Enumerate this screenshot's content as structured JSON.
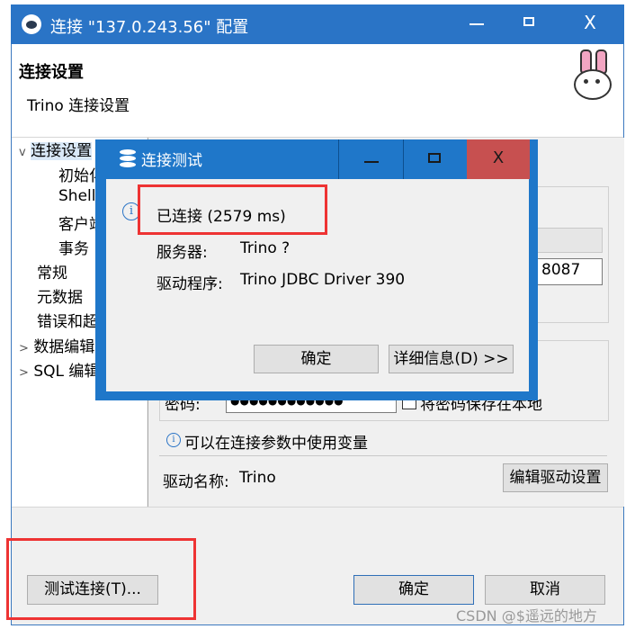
{
  "window": {
    "title": "连接 \"137.0.243.56\" 配置",
    "controls": [
      "minimize-icon",
      "maximize-icon",
      "close-icon"
    ],
    "close_glyph": "X"
  },
  "header": {
    "title": "连接设置",
    "subtitle": "Trino 连接设置"
  },
  "sidebar": {
    "items": [
      {
        "label": "连接设置",
        "chevron": "v"
      },
      {
        "label": "初始化"
      },
      {
        "label": "Shell"
      },
      {
        "label": "客户端"
      },
      {
        "label": "事务"
      },
      {
        "label": "常规"
      },
      {
        "label": "元数据"
      },
      {
        "label": "错误和超"
      },
      {
        "label": "数据编辑",
        "chevron": ">"
      },
      {
        "label": "SQL 编辑",
        "chevron": ">"
      }
    ]
  },
  "main": {
    "port_value": "8087",
    "password_label": "密码:",
    "password_value": "●●●●●●●●●●●●",
    "save_password_label": "将密码保存在本地",
    "variables_hint": "可以在连接参数中使用变量",
    "driver_label": "驱动名称:",
    "driver_value": "Trino",
    "edit_driver_button": "编辑驱动设置"
  },
  "footer": {
    "test_connection_button": "测试连接(T)...",
    "ok_button": "确定",
    "cancel_button": "取消"
  },
  "dialog": {
    "title": "连接测试",
    "status": "已连接 (2579 ms)",
    "server_label": "服务器:",
    "server_value": "Trino ?",
    "driver_label": "驱动程序:",
    "driver_value": "Trino JDBC Driver 390",
    "ok_button": "确定",
    "details_button": "详细信息(D) >>",
    "close_glyph": "X"
  },
  "watermark": "CSDN @$遥远的地方",
  "colors": {
    "titlebar": "#2a74c6",
    "dialog_frame": "#1f77c9",
    "dialog_close": "#c75050",
    "highlight_box": "#ee3333"
  }
}
